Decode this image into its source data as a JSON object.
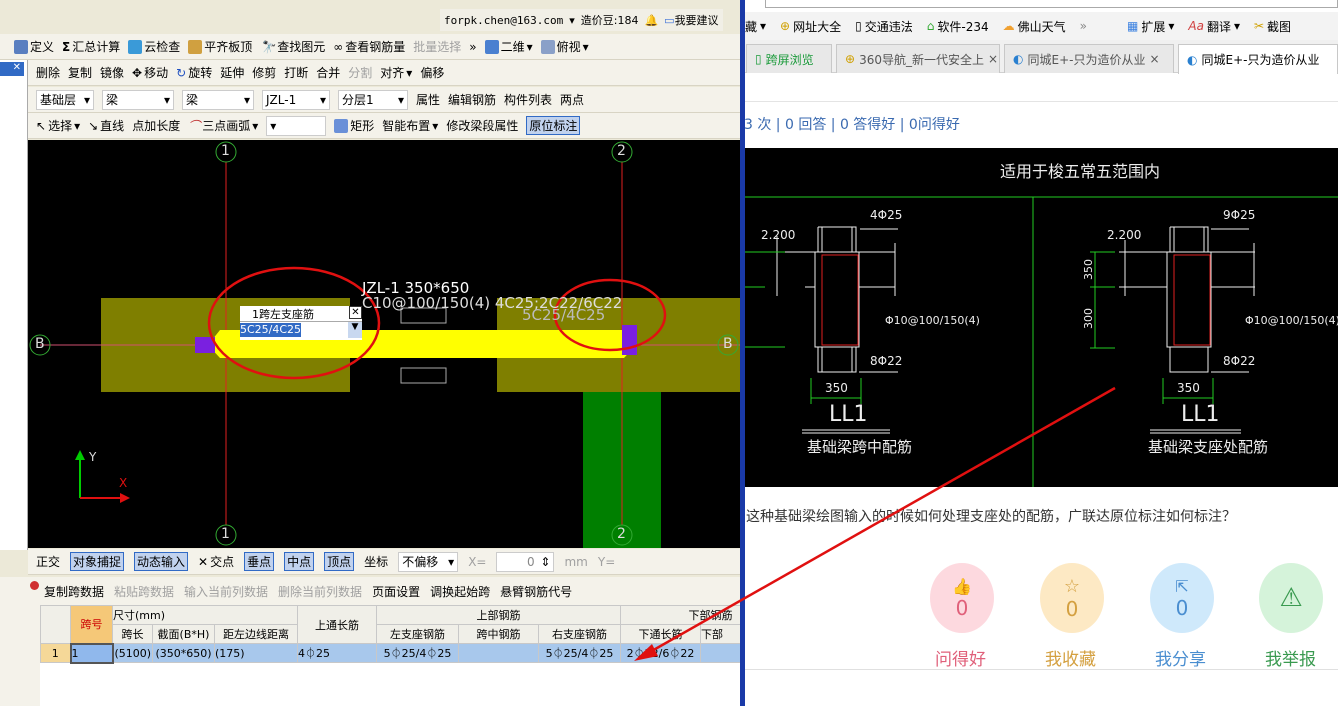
{
  "account": {
    "email": "forpk.chen@163.com",
    "beans": "造价豆:184",
    "suggest": "我要建议"
  },
  "toolbar1": [
    "定义",
    "汇总计算",
    "云检查",
    "平齐板顶",
    "查找图元",
    "查看钢筋量",
    "批量选择",
    "二维",
    "俯视"
  ],
  "toolbar2": [
    "删除",
    "复制",
    "镜像",
    "移动",
    "旋转",
    "延伸",
    "修剪",
    "打断",
    "合并",
    "分割",
    "对齐",
    "偏移"
  ],
  "toolbar3": {
    "floor": "基础层",
    "type1": "梁",
    "type2": "梁",
    "element": "JZL-1",
    "layer": "分层1",
    "items": [
      "属性",
      "编辑钢筋",
      "构件列表",
      "两点"
    ]
  },
  "toolbar4": [
    "选择",
    "直线",
    "点加长度",
    "三点画弧",
    "矩形",
    "智能布置",
    "修改梁段属性",
    "原位标注"
  ],
  "more": "»",
  "cad": {
    "axis1": "1",
    "axis2": "2",
    "axisB": "B",
    "beam_label": "JZL-1 350*650",
    "beam_spec": "C10@100/150(4) 4C25;2C22/6C22",
    "right_support": "5C25/4C25",
    "popup_title": "1跨左支座筋",
    "popup_value": "5C25/4C25",
    "x": "X",
    "y": "Y"
  },
  "statusbar": {
    "items": [
      "正交",
      "对象捕捉",
      "动态输入",
      "交点",
      "垂点",
      "中点",
      "顶点",
      "坐标"
    ],
    "offset": "不偏移",
    "x_label": "X=",
    "x_value": "0",
    "unit": "mm",
    "y_label": "Y="
  },
  "table_toolbar": [
    "复制跨数据",
    "粘贴跨数据",
    "输入当前列数据",
    "删除当前列数据",
    "页面设置",
    "调换起始跨",
    "悬臂钢筋代号"
  ],
  "table": {
    "group_headers": {
      "span_no": "跨号",
      "size": "尺寸(mm)",
      "top_long": "上通长筋",
      "top_rebar": "上部钢筋",
      "bottom_rebar": "下部钢筋"
    },
    "sub_headers": [
      "跨长",
      "截面(B*H)",
      "距左边线距离",
      "左支座钢筋",
      "跨中钢筋",
      "右支座钢筋",
      "下通长筋",
      "下部"
    ],
    "rows": [
      {
        "row": "1",
        "span": "1",
        "length": "(5100)",
        "section": "(350*650)",
        "offset": "(175)",
        "top_long": "4⏀25",
        "left": "5⏀25/4⏀25",
        "mid": "",
        "right": "5⏀25/4⏀25",
        "bottom_long": "2⏀22/6⏀22"
      }
    ]
  },
  "browser": {
    "bookmarks": [
      "藏",
      "网址大全",
      "交通违法",
      "软件-234",
      "佛山天气",
      "»",
      "扩展",
      "翻译",
      "截图"
    ],
    "tabs": [
      "跨屏浏览",
      "360导航_新一代安全上",
      "同城E+-只为造价从业",
      "同城E+-只为造价从业"
    ],
    "stats": "3 次 | 0 回答 | 0 答得好 | 0问得好",
    "drawing": {
      "title": "适用于梭五常五范围内",
      "l_top": "4Φ25",
      "r_top": "9Φ25",
      "elev": "2.200",
      "stirrup": "Φ10@100/150(4)",
      "bottom": "8Φ22",
      "width": "350",
      "h1": "350",
      "h2": "300",
      "name": "LL1",
      "l_caption": "基础梁跨中配筋",
      "r_caption": "基础梁支座处配筋"
    },
    "question": "这种基础梁绘图输入的时候如何处理支座处的配筋，广联达原位标注如何标注？",
    "actions": [
      {
        "icon": "thumbs-up",
        "count": "0",
        "label": "问得好",
        "color": "#e0607a",
        "bg": "#fdd9df"
      },
      {
        "icon": "star",
        "count": "0",
        "label": "我收藏",
        "color": "#d4a040",
        "bg": "#fde9c4"
      },
      {
        "icon": "share",
        "count": "0",
        "label": "我分享",
        "color": "#4a8ed0",
        "bg": "#cfe9fb"
      },
      {
        "icon": "warning",
        "count": "",
        "label": "我举报",
        "color": "#3a9a50",
        "bg": "#d5f3da"
      }
    ]
  }
}
